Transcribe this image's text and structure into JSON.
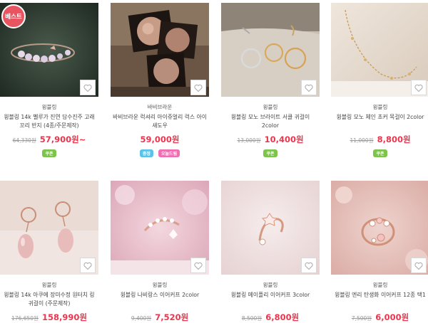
{
  "products": [
    {
      "badge": "베스트",
      "brand": "윙블링",
      "name": "윙블링 14k 벨루가 진연 담수진주 고래꼬리 반지 (4종/주문제작)",
      "orig_price": "64,330원",
      "sale_price": "57,900원~",
      "tags": [
        {
          "label": "쿠폰",
          "color": "#7cc44a"
        }
      ]
    },
    {
      "brand": "바비브라운",
      "name": "바비브라운 럭셔리 아이쥬얼리 럭스 아이섀도우",
      "orig_price": "",
      "sale_price": "59,000원",
      "tags": [
        {
          "label": "증정",
          "color": "#5bc3ea"
        },
        {
          "label": "오늘드림",
          "color": "#ef6fb0"
        }
      ]
    },
    {
      "brand": "윙블링",
      "name": "윙블링 모노 브라이트 서클 귀걸이 2color",
      "orig_price": "13,000원",
      "sale_price": "10,400원",
      "tags": [
        {
          "label": "쿠폰",
          "color": "#7cc44a"
        }
      ]
    },
    {
      "brand": "윙블링",
      "name": "윙블링 모노 체인 초커 목걸이 2color",
      "orig_price": "11,000원",
      "sale_price": "8,800원",
      "tags": [
        {
          "label": "쿠폰",
          "color": "#7cc44a"
        }
      ]
    },
    {
      "brand": "윙블링",
      "name": "윙블링 14k 아쿠에 장미수정 원터치 링 귀걸이 (주문제작)",
      "orig_price": "176,650원",
      "sale_price": "158,990원",
      "tags": []
    },
    {
      "brand": "윙블링",
      "name": "윙블링 나비랑스 이어커프 2color",
      "orig_price": "9,400원",
      "sale_price": "7,520원",
      "tags": []
    },
    {
      "brand": "윙블링",
      "name": "윙블링 메이플리 이어커프 3color",
      "orig_price": "8,500원",
      "sale_price": "6,800원",
      "tags": []
    },
    {
      "brand": "윙블링",
      "name": "윙블링 엔리 탄생화 이어커프 12종 택1",
      "orig_price": "7,500원",
      "sale_price": "6,000원",
      "tags": []
    }
  ],
  "icons": {
    "wish": "heart-outline-icon"
  }
}
